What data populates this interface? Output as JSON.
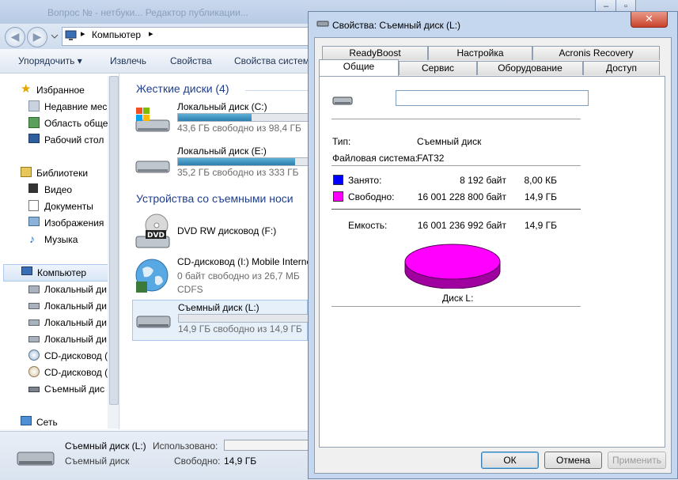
{
  "explorer": {
    "title": "Вопрос № - нетбуки... Редактор публикации...",
    "address": "Компьютер",
    "toolbar": [
      "Упорядочить ▾",
      "Извлечь",
      "Свойства",
      "Свойства систем"
    ],
    "nav": {
      "favorites": "Избранное",
      "fav_items": [
        "Недавние мес",
        "Область обще",
        "Рабочий стол"
      ],
      "libraries": "Библиотеки",
      "lib_items": [
        "Видео",
        "Документы",
        "Изображения",
        "Музыка"
      ],
      "computer": "Компьютер",
      "comp_items": [
        "Локальный ди",
        "Локальный ди",
        "Локальный ди",
        "Локальный ди",
        "CD-дисковод (",
        "CD-дисковод (",
        "Съемный дис"
      ],
      "network": "Сеть"
    },
    "content": {
      "hdd_group": "Жесткие диски (4)",
      "removable_group": "Устройства со съемными носи",
      "drives": [
        {
          "name": "Локальный диск (C:)",
          "free": "43,6 ГБ свободно из 98,4 ГБ",
          "used_fraction": 0.56
        },
        {
          "name": "Локальный диск (E:)",
          "free": "35,2 ГБ свободно из 333 ГБ",
          "used_fraction": 0.89
        },
        {
          "name": "DVD RW дисковод (F:)"
        },
        {
          "name": "CD-дисковод (I:) Mobile Interne",
          "free": "0 байт свободно из 26,7 МБ",
          "fs": "CDFS"
        },
        {
          "name": "Съемный диск (L:)",
          "free": "14,9 ГБ свободно из 14,9 ГБ",
          "used_fraction": 0.0
        }
      ]
    },
    "details": {
      "name": "Съемный диск (L:)",
      "type": "Съемный диск",
      "used_label": "Использовано:",
      "free_label": "Свободно:",
      "free_value": "14,9 ГБ"
    }
  },
  "dialog": {
    "title": "Свойства: Съемный диск (L:)",
    "tabs_top": [
      "ReadyBoost",
      "Настройка",
      "Acronis Recovery"
    ],
    "tabs_bottom": [
      "Общие",
      "Сервис",
      "Оборудование",
      "Доступ"
    ],
    "label_value": "",
    "type_label": "Тип:",
    "type_value": "Съемный диск",
    "fs_label": "Файловая система:",
    "fs_value": "FAT32",
    "used_label": "Занято:",
    "used_bytes": "8 192 байт",
    "used_size": "8,00 КБ",
    "free_label": "Свободно:",
    "free_bytes": "16 001 228 800 байт",
    "free_size": "14,9 ГБ",
    "capacity_label": "Емкость:",
    "capacity_bytes": "16 001 236 992 байт",
    "capacity_size": "14,9 ГБ",
    "disk_label": "Диск L:",
    "used_color": "#0000ff",
    "free_color": "#ff00ff",
    "ok": "ОК",
    "cancel": "Отмена",
    "apply": "Применить"
  }
}
